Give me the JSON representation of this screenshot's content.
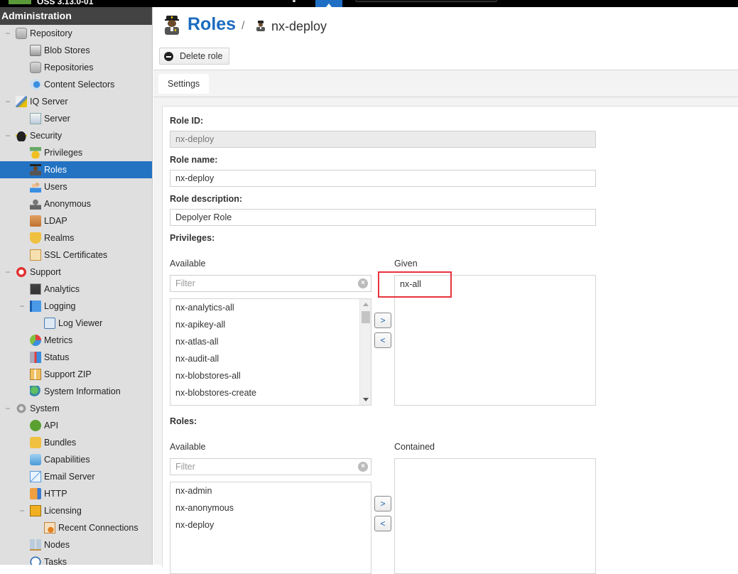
{
  "topbar": {
    "version": "OSS 3.13.0-01"
  },
  "sidebar": {
    "header": "Administration",
    "items": [
      {
        "label": "Repository",
        "level": 0,
        "toggle": "−",
        "icon": "database-icon"
      },
      {
        "label": "Blob Stores",
        "level": 1,
        "icon": "blob-store-icon"
      },
      {
        "label": "Repositories",
        "level": 1,
        "icon": "database-icon"
      },
      {
        "label": "Content Selectors",
        "level": 1,
        "icon": "content-selector-icon"
      },
      {
        "label": "IQ Server",
        "level": 0,
        "toggle": "−",
        "icon": "iq-server-icon"
      },
      {
        "label": "Server",
        "level": 1,
        "icon": "server-icon"
      },
      {
        "label": "Security",
        "level": 0,
        "toggle": "−",
        "icon": "security-cap-icon"
      },
      {
        "label": "Privileges",
        "level": 1,
        "icon": "medal-icon"
      },
      {
        "label": "Roles",
        "level": 1,
        "icon": "role-officer-icon",
        "selected": true
      },
      {
        "label": "Users",
        "level": 1,
        "icon": "users-icon"
      },
      {
        "label": "Anonymous",
        "level": 1,
        "icon": "anonymous-user-icon"
      },
      {
        "label": "LDAP",
        "level": 1,
        "icon": "address-book-icon"
      },
      {
        "label": "Realms",
        "level": 1,
        "icon": "shield-icon"
      },
      {
        "label": "SSL Certificates",
        "level": 1,
        "icon": "certificate-icon"
      },
      {
        "label": "Support",
        "level": 0,
        "toggle": "−",
        "icon": "lifebuoy-icon"
      },
      {
        "label": "Analytics",
        "level": 1,
        "icon": "analytics-monitor-icon"
      },
      {
        "label": "Logging",
        "level": 1,
        "toggle": "−",
        "icon": "book-icon"
      },
      {
        "label": "Log Viewer",
        "level": 2,
        "icon": "log-scroll-icon"
      },
      {
        "label": "Metrics",
        "level": 1,
        "icon": "pie-chart-icon"
      },
      {
        "label": "Status",
        "level": 1,
        "icon": "status-chart-icon"
      },
      {
        "label": "Support ZIP",
        "level": 1,
        "icon": "zip-file-icon"
      },
      {
        "label": "System Information",
        "level": 1,
        "icon": "globe-icon"
      },
      {
        "label": "System",
        "level": 0,
        "toggle": "−",
        "icon": "gear-icon"
      },
      {
        "label": "API",
        "level": 1,
        "icon": "api-badge-icon"
      },
      {
        "label": "Bundles",
        "level": 1,
        "icon": "puzzle-icon"
      },
      {
        "label": "Capabilities",
        "level": 1,
        "icon": "cube-icon"
      },
      {
        "label": "Email Server",
        "level": 1,
        "icon": "envelope-icon"
      },
      {
        "label": "HTTP",
        "level": 1,
        "icon": "truck-icon"
      },
      {
        "label": "Licensing",
        "level": 1,
        "toggle": "−",
        "icon": "license-card-icon"
      },
      {
        "label": "Recent Connections",
        "level": 2,
        "icon": "recent-connections-icon"
      },
      {
        "label": "Nodes",
        "level": 1,
        "icon": "nodes-icon"
      },
      {
        "label": "Tasks",
        "level": 1,
        "icon": "clock-icon"
      }
    ]
  },
  "header": {
    "title": "Roles",
    "separator": "/",
    "breadcrumb": "nx-deploy"
  },
  "toolbar": {
    "delete_label": "Delete role"
  },
  "tabs": [
    {
      "label": "Settings",
      "active": true
    }
  ],
  "form": {
    "role_id_label": "Role ID:",
    "role_id_value": "nx-deploy",
    "role_name_label": "Role name:",
    "role_name_value": "nx-deploy",
    "role_description_label": "Role description:",
    "role_description_value": "Depolyer Role",
    "privileges": {
      "label": "Privileges:",
      "available_label": "Available",
      "given_label": "Given",
      "filter_placeholder": "Filter",
      "available": [
        "nx-analytics-all",
        "nx-apikey-all",
        "nx-atlas-all",
        "nx-audit-all",
        "nx-blobstores-all",
        "nx-blobstores-create"
      ],
      "given": [
        "nx-all"
      ],
      "add_label": ">",
      "remove_label": "<"
    },
    "roles": {
      "label": "Roles:",
      "available_label": "Available",
      "contained_label": "Contained",
      "filter_placeholder": "Filter",
      "available": [
        "nx-admin",
        "nx-anonymous",
        "nx-deploy"
      ],
      "contained": [],
      "add_label": ">",
      "remove_label": "<"
    }
  },
  "colors": {
    "accent": "#2373c2",
    "title": "#1b6bbf",
    "highlight": "#e8323c",
    "sidebar_header": "#434343"
  }
}
